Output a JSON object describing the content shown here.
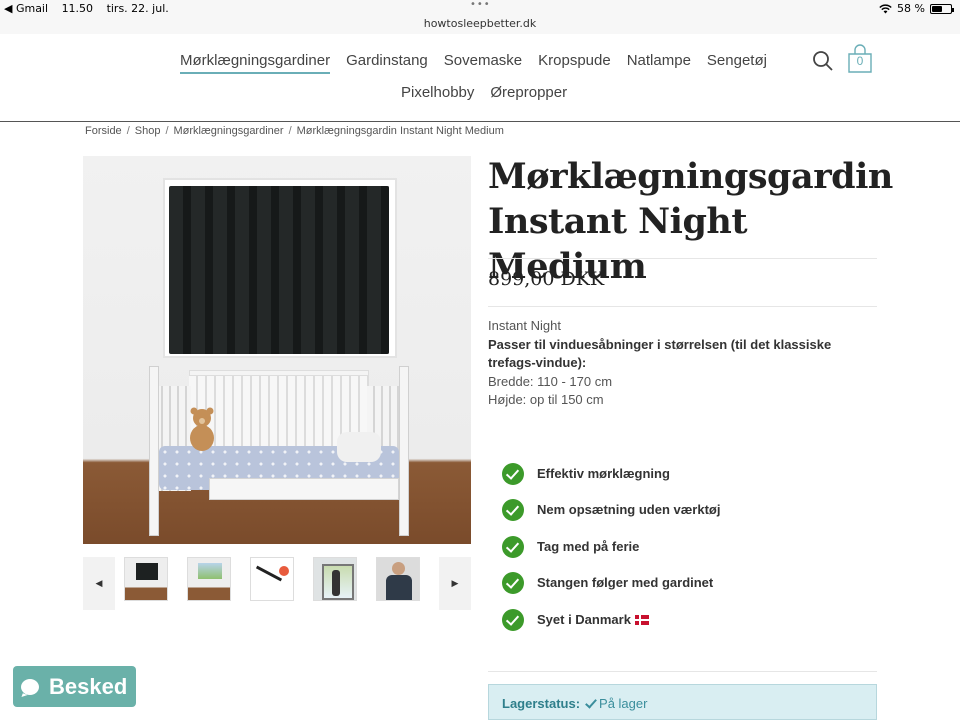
{
  "status_bar": {
    "back_app": "◀ Gmail",
    "time": "11.50",
    "date": "tirs. 22. jul.",
    "dots": "•••",
    "url": "howtosleepbetter.dk",
    "battery": "58 %",
    "battery_level": 0.58
  },
  "nav": {
    "items": [
      "Mørklægningsgardiner",
      "Gardinstang",
      "Sovemaske",
      "Kropspude",
      "Natlampe",
      "Sengetøj"
    ],
    "items_row2": [
      "Pixelhobby",
      "Ørepropper"
    ],
    "cart_count": "0",
    "icons": [
      "search-icon",
      "shopping-bag-icon"
    ],
    "accent_color": "#6aaeb7"
  },
  "breadcrumb": [
    "Forside",
    "Shop",
    "Mørklægningsgardiner",
    "Mørklægningsgardin Instant Night Medium"
  ],
  "product": {
    "title": "Mørklægningsgardin Instant Night Medium",
    "price": "899,00 DKK",
    "brand": "Instant Night",
    "fit_heading": "Passer til vinduesåbninger i størrelsen (til det klassiske trefags-vindue):",
    "width": "Bredde: 110 - 170 cm",
    "height": "Højde: op til 150 cm",
    "features": [
      "Effektiv mørklægning",
      "Nem opsætning uden værktøj",
      "Tag med på ferie",
      "Stangen følger med gardinet",
      "Syet i Danmark"
    ],
    "feature_check_color": "#3c9a2a",
    "stock_label": "Lagerstatus:",
    "stock_value": "På lager"
  },
  "gallery": {
    "thumbnail_count": 5,
    "prev_icon": "chevron-left-icon",
    "next_icon": "chevron-right-icon"
  },
  "chat": {
    "label": "Besked",
    "color": "#6ab1a9"
  }
}
